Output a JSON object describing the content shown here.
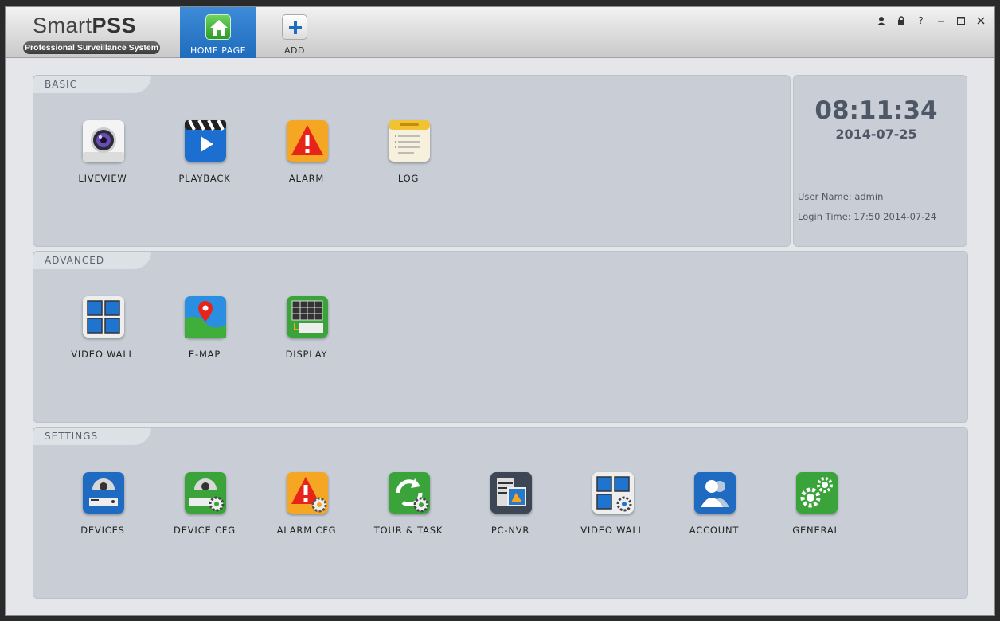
{
  "app": {
    "logo_word_light": "Smart",
    "logo_word_bold": "PSS",
    "logo_tagline": "Professional Surveillance System"
  },
  "nav": {
    "tabs": [
      {
        "label": "HOME PAGE",
        "icon": "home-icon",
        "active": true
      },
      {
        "label": "ADD",
        "icon": "plus-icon",
        "active": false
      }
    ]
  },
  "window_controls": [
    "user-icon",
    "lock-icon",
    "help-icon",
    "minimize-icon",
    "maximize-icon",
    "close-icon"
  ],
  "sections": {
    "basic": {
      "title": "BASIC",
      "items": [
        {
          "label": "LIVEVIEW",
          "icon": "camera-lens-icon"
        },
        {
          "label": "PLAYBACK",
          "icon": "clapperboard-play-icon"
        },
        {
          "label": "ALARM",
          "icon": "alarm-warning-icon"
        },
        {
          "label": "LOG",
          "icon": "notepad-log-icon"
        }
      ]
    },
    "advanced": {
      "title": "ADVANCED",
      "items": [
        {
          "label": "VIDEO WALL",
          "icon": "video-wall-grid-icon"
        },
        {
          "label": "E-MAP",
          "icon": "map-pin-icon"
        },
        {
          "label": "DISPLAY",
          "icon": "display-screen-icon"
        }
      ]
    },
    "settings": {
      "title": "SETTINGS",
      "items": [
        {
          "label": "DEVICES",
          "icon": "dome-camera-icon"
        },
        {
          "label": "DEVICE CFG",
          "icon": "dome-camera-gear-icon"
        },
        {
          "label": "ALARM CFG",
          "icon": "alarm-gear-icon"
        },
        {
          "label": "TOUR & TASK",
          "icon": "refresh-gear-icon"
        },
        {
          "label": "PC-NVR",
          "icon": "pc-nvr-icon"
        },
        {
          "label": "VIDEO WALL",
          "icon": "video-wall-gear-icon"
        },
        {
          "label": "ACCOUNT",
          "icon": "account-users-icon"
        },
        {
          "label": "GENERAL",
          "icon": "general-gears-icon"
        }
      ]
    }
  },
  "status": {
    "time": "08:11:34",
    "date": "2014-07-25",
    "user_name_label": "User Name:",
    "user_name": "admin",
    "login_time_label": "Login Time:",
    "login_time": "17:50 2014-07-24"
  },
  "colors": {
    "active_tab": "#2a78c8",
    "panel_bg": "#c9ced6",
    "panel_title": "#596270",
    "clock_text": "#4e5766"
  }
}
